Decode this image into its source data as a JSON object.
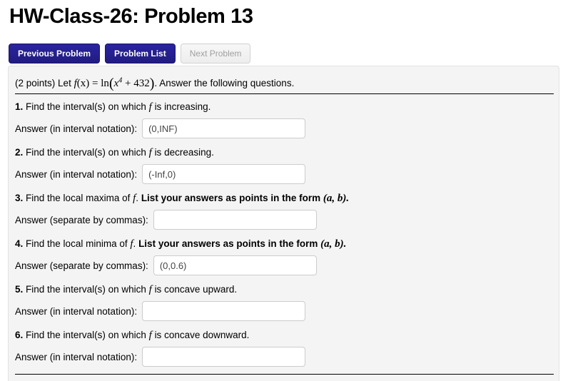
{
  "page_title": "HW-Class-26: Problem 13",
  "nav_buttons": [
    {
      "label": "Previous Problem",
      "state": "enabled"
    },
    {
      "label": "Problem List",
      "state": "enabled"
    },
    {
      "label": "Next Problem",
      "state": "disabled"
    }
  ],
  "problem": {
    "points_text": "(2 points)",
    "let_text": "Let",
    "function_name": "f",
    "function_arg": "(x)",
    "equals": "=",
    "ln": "ln",
    "open_paren": "(",
    "base": "x",
    "exponent": "4",
    "plus": "+",
    "constant": "432",
    "close_paren": ")",
    "trailing_text": ". Answer the following questions.",
    "statement_plain": "(2 points) Let f(x) = ln(x^4 + 432) . Answer the following questions."
  },
  "questions": [
    {
      "number": "1.",
      "prompt_before_f": "Find the interval(s) on which",
      "f": "f",
      "prompt_after_f": "is increasing.",
      "bold_tail": "",
      "answer_label": "Answer (in interval notation):",
      "answer_value": "(0,INF)",
      "answer_placeholder": ""
    },
    {
      "number": "2.",
      "prompt_before_f": "Find the interval(s) on which",
      "f": "f",
      "prompt_after_f": "is decreasing.",
      "bold_tail": "",
      "answer_label": "Answer (in interval notation):",
      "answer_value": "(-Inf,0)",
      "answer_placeholder": ""
    },
    {
      "number": "3.",
      "prompt_before_f": "Find the local maxima of",
      "f": "f",
      "prompt_after_f": ".",
      "bold_tail": "List your answers as points in the form",
      "bold_tail_math": "(a, b).",
      "answer_label": "Answer (separate by commas):",
      "answer_value": "",
      "answer_placeholder": ""
    },
    {
      "number": "4.",
      "prompt_before_f": "Find the local minima of",
      "f": "f",
      "prompt_after_f": ".",
      "bold_tail": "List your answers as points in the form",
      "bold_tail_math": "(a, b).",
      "answer_label": "Answer (separate by commas):",
      "answer_value": "(0,0.6)",
      "answer_placeholder": ""
    },
    {
      "number": "5.",
      "prompt_before_f": "Find the interval(s) on which",
      "f": "f",
      "prompt_after_f": "is concave upward.",
      "bold_tail": "",
      "answer_label": "Answer (in interval notation):",
      "answer_value": "",
      "answer_placeholder": ""
    },
    {
      "number": "6.",
      "prompt_before_f": "Find the interval(s) on which",
      "f": "f",
      "prompt_after_f": "is concave downward.",
      "bold_tail": "",
      "answer_label": "Answer (in interval notation):",
      "answer_value": "",
      "answer_placeholder": ""
    }
  ],
  "colors": {
    "primary_button": "#241f8c",
    "disabled_button_bg": "#f2f2f2",
    "disabled_button_text": "#a0a0a0",
    "panel_bg": "#f4f4f4",
    "input_border": "#cccccc",
    "page_bg": "#ffffff"
  }
}
